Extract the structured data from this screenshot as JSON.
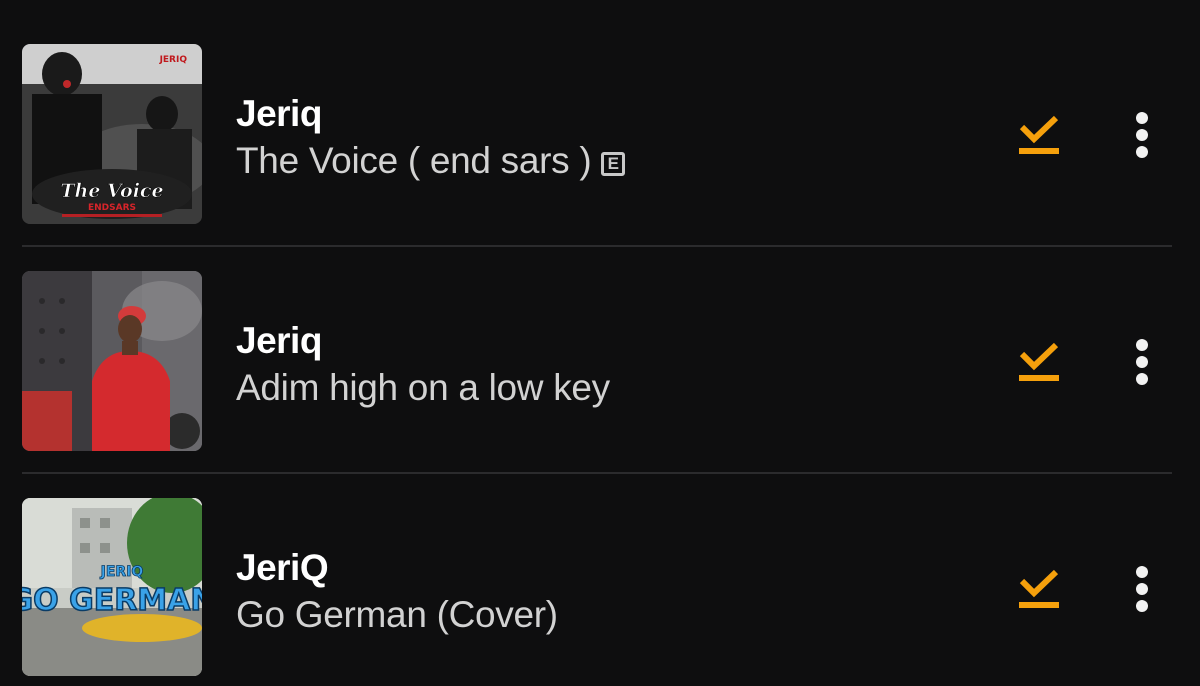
{
  "accent_color": "#f5a00c",
  "tracks": [
    {
      "artist": "Jeriq",
      "title": "The Voice ( end sars )",
      "explicit": true,
      "explicit_label": "E",
      "downloaded": true,
      "download_icon": "download-done-icon",
      "more_icon": "more-vertical-icon",
      "artwork_text": "The Voice",
      "artwork_subtext": "ENDSARS",
      "artwork_logo": "JERIQ"
    },
    {
      "artist": "Jeriq",
      "title": "Adim high on a low key",
      "explicit": false,
      "downloaded": true,
      "download_icon": "download-done-icon",
      "more_icon": "more-vertical-icon"
    },
    {
      "artist": "JeriQ",
      "title": "Go German (Cover)",
      "explicit": false,
      "downloaded": true,
      "download_icon": "download-done-icon",
      "more_icon": "more-vertical-icon",
      "artwork_text": "GO GERMAN",
      "artwork_logo": "JERIQ"
    }
  ]
}
